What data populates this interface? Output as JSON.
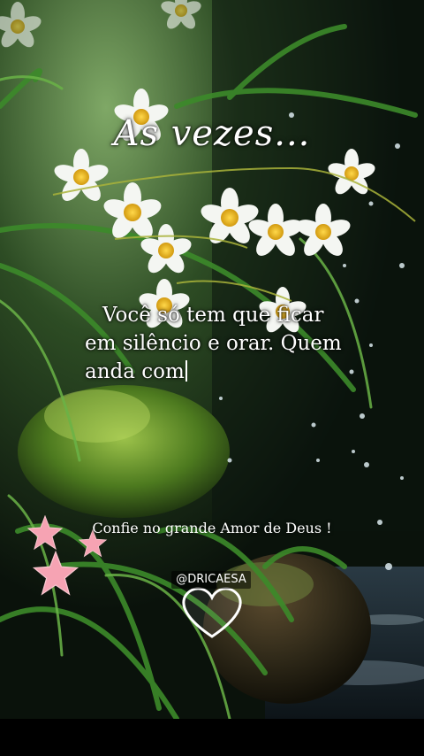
{
  "overlay": {
    "title": "As vezes...",
    "message_lines": [
      "Você só tem que ficar",
      "em silêncio e orar. Quem",
      "anda com"
    ],
    "caption": "Confie no grande Amor de Deus !",
    "handle": "@DRICAESA"
  },
  "decorations": {
    "star_icon": "star-icon",
    "heart_icon": "heart-outline-icon",
    "star_color": "#f6a3b3"
  },
  "colors": {
    "background": "#0c0f0c",
    "foliage": "#2f6b25",
    "flower_petal": "#f4f6f2",
    "flower_center": "#e0b21b",
    "text": "#ffffff"
  }
}
